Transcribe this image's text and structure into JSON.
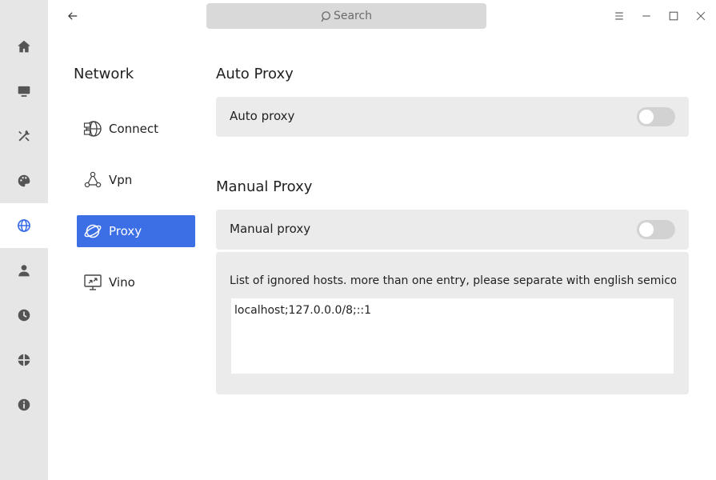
{
  "rail": {
    "items": [
      {
        "icon": "home-icon",
        "active": false
      },
      {
        "icon": "monitor-icon",
        "active": false
      },
      {
        "icon": "tools-icon",
        "active": false
      },
      {
        "icon": "palette-icon",
        "active": false
      },
      {
        "icon": "globe-icon",
        "active": true
      },
      {
        "icon": "user-icon",
        "active": false
      },
      {
        "icon": "clock-icon",
        "active": false
      },
      {
        "icon": "update-icon",
        "active": false
      },
      {
        "icon": "info-icon",
        "active": false
      }
    ]
  },
  "header": {
    "search_placeholder": "Search"
  },
  "nav": {
    "title": "Network",
    "items": [
      {
        "label": "Connect",
        "icon": "network-icon",
        "active": false
      },
      {
        "label": "Vpn",
        "icon": "vpn-icon",
        "active": false
      },
      {
        "label": "Proxy",
        "icon": "planet-icon",
        "active": true
      },
      {
        "label": "Vino",
        "icon": "screen-share-icon",
        "active": false
      }
    ]
  },
  "auto_proxy": {
    "section_title": "Auto Proxy",
    "row_label": "Auto proxy",
    "enabled": false
  },
  "manual_proxy": {
    "section_title": "Manual Proxy",
    "row_label": "Manual proxy",
    "enabled": false,
    "ignored_hosts_label": "List of ignored hosts. more than one entry, please separate with english semicolon",
    "ignored_hosts_value": "localhost;127.0.0.0/8;::1"
  },
  "colors": {
    "accent": "#3c6fe6",
    "rail_bg": "#e6e6e6",
    "card_bg": "#ebebeb"
  }
}
